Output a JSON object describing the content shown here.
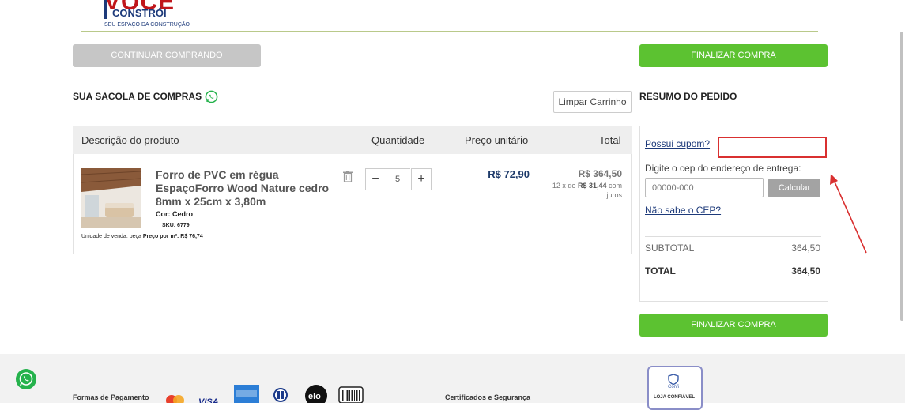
{
  "header": {
    "logo_main": "VOCÊ",
    "logo_sub": "CONSTRÓI",
    "logo_tagline": "SEU ESPAÇO DA CONSTRUÇÃO"
  },
  "actions": {
    "continue_shopping": "CONTINUAR COMPRANDO",
    "checkout": "FINALIZAR COMPRA",
    "clear_cart": "Limpar Carrinho"
  },
  "cart": {
    "title": "SUA SACOLA DE COMPRAS",
    "columns": {
      "description": "Descrição do produto",
      "quantity": "Quantidade",
      "unit_price": "Preço unitário",
      "total": "Total"
    },
    "items": [
      {
        "name": "Forro de PVC em régua EspaçoForro Wood Nature cedro 8mm x 25cm x 3,80m",
        "color": "Cor: Cedro",
        "sku": "SKU: 6779",
        "unit_sale": "Unidade de venda: peça",
        "price_per_m2": "Preço por m²: R$ 76,74",
        "quantity": "5",
        "unit_price": "R$ 72,90",
        "total": "R$ 364,50",
        "installment_prefix": "12 x de",
        "installment_value": "R$ 31,44",
        "installment_suffix": "com juros"
      }
    ]
  },
  "summary": {
    "title": "RESUMO DO PEDIDO",
    "coupon_link": "Possui cupom?",
    "cep_label": "Digite o cep do endereço de entrega:",
    "cep_placeholder": "00000-000",
    "calculate": "Calcular",
    "cep_unknown": "Não sabe o CEP?",
    "subtotal_label": "SUBTOTAL",
    "subtotal_value": "364,50",
    "total_label": "TOTAL",
    "total_value": "364,50"
  },
  "footer": {
    "payment_label": "Formas de Pagamento",
    "security_label": "Certificados e Segurança",
    "seal_brand": "Confi",
    "seal_text": "LOJA CONFIÁVEL"
  },
  "colors": {
    "green": "#5cc231",
    "navy": "#1d3a7a",
    "brand_red": "#c0161b",
    "annotation_red": "#d93030"
  }
}
